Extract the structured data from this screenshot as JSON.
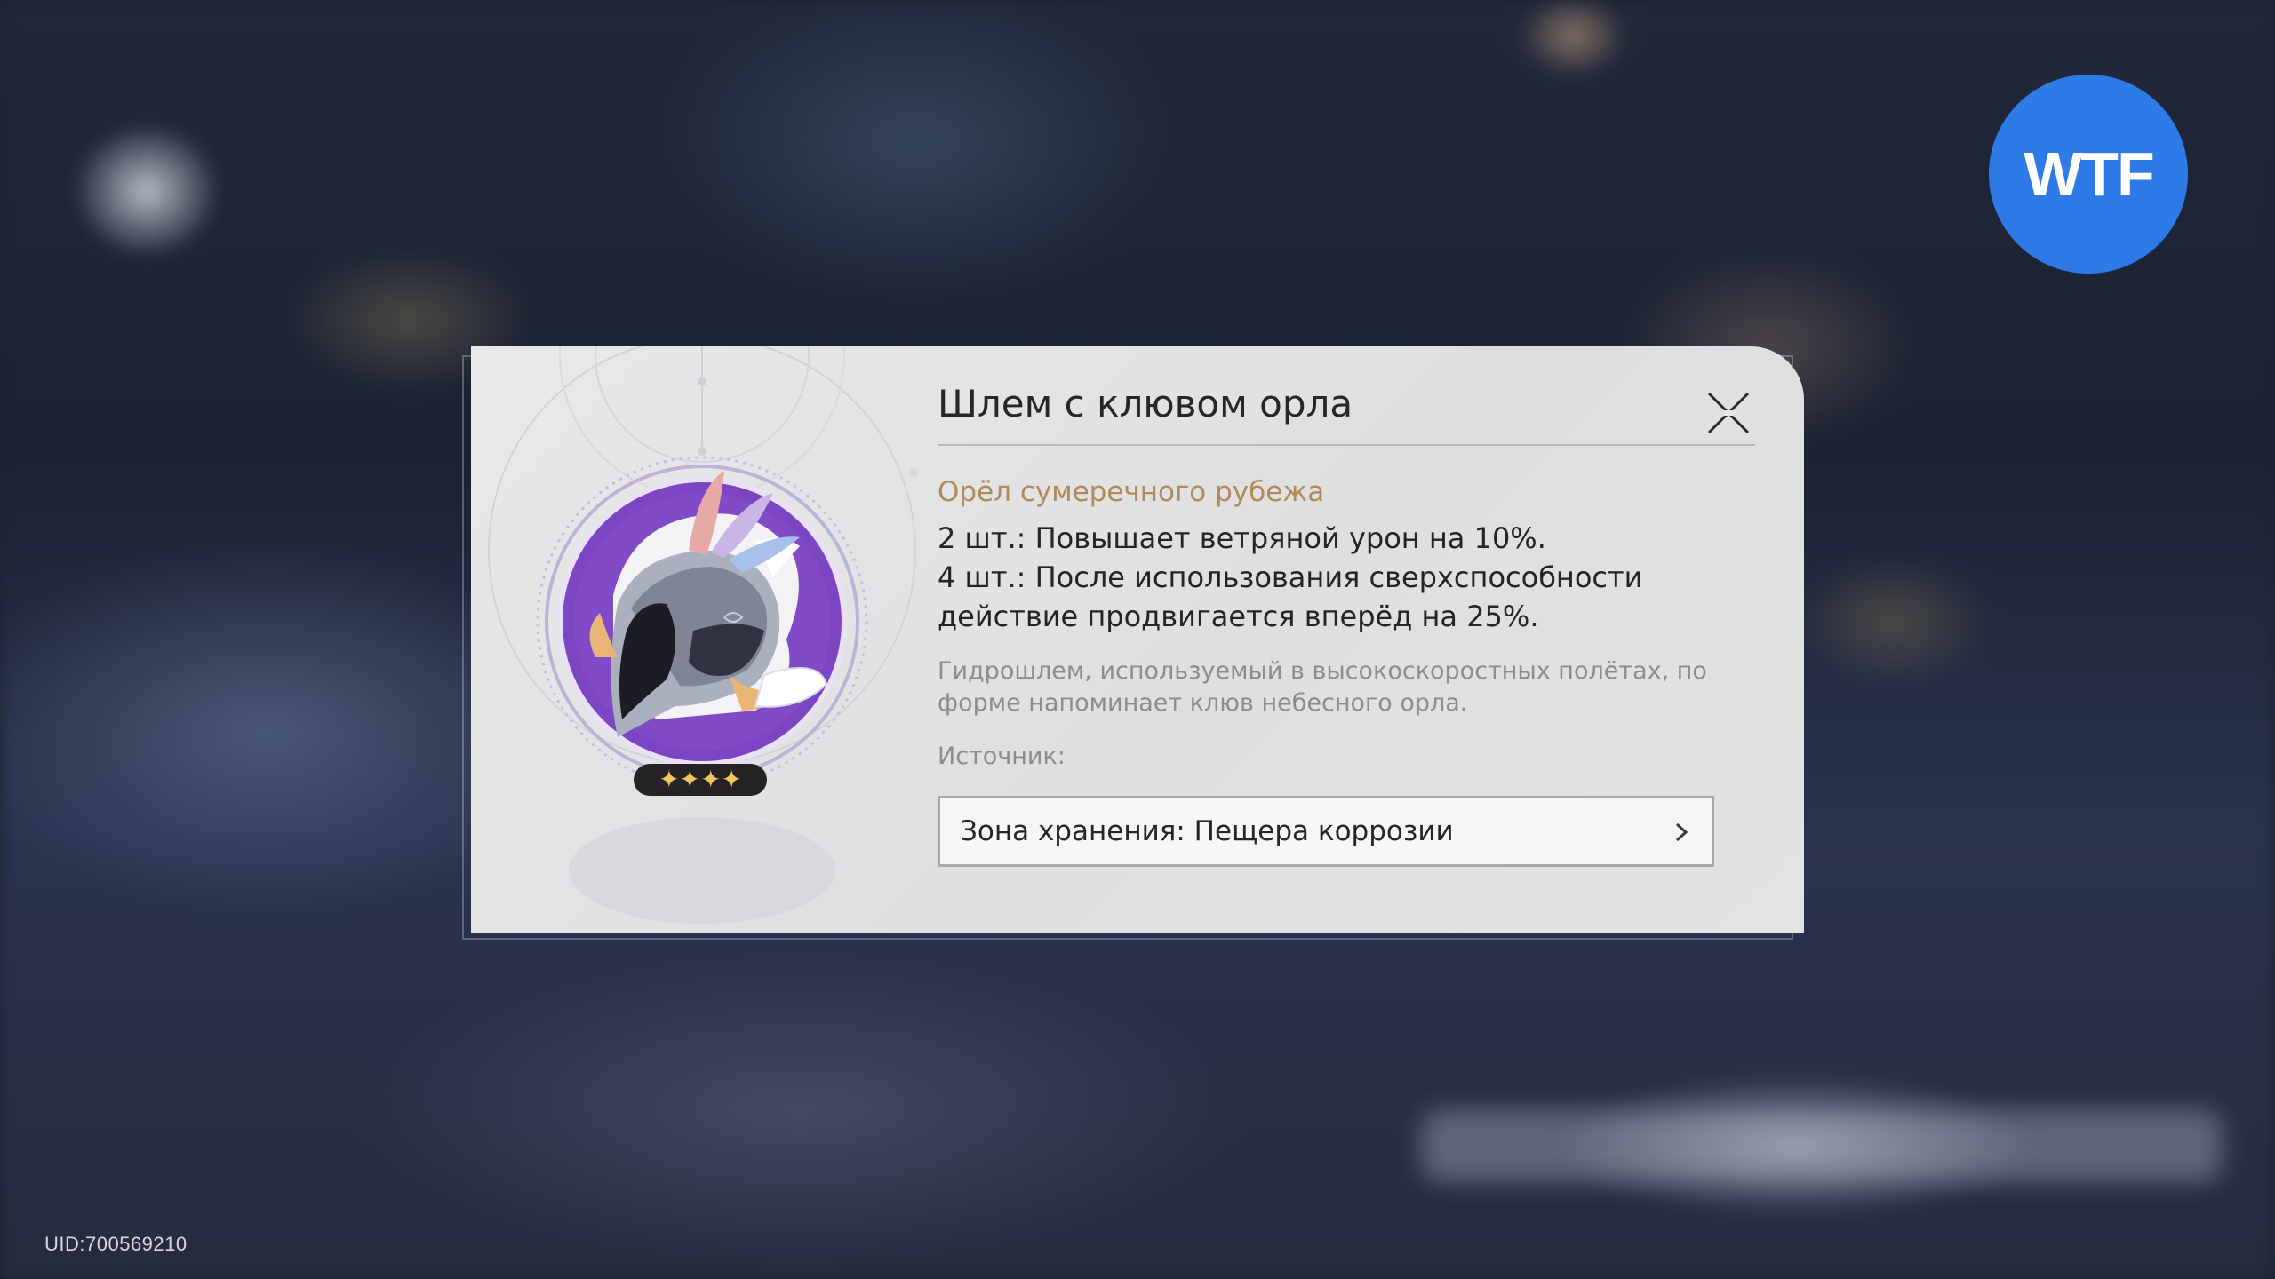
{
  "badge": {
    "text": "WTF",
    "color": "#2e7be8"
  },
  "uid": "UID:700569210",
  "item": {
    "title": "Шлем с клювом орла",
    "rarity_stars": 4,
    "star_glyphs": "✦✦✦✦",
    "set_name": "Орёл сумеречного рубежа",
    "effects": {
      "two_piece": "2 шт.: Повышает ветряной урон на 10%.",
      "four_piece": "4 шт.: После использования сверхспособности действие продвигается вперёд на 25%."
    },
    "description": "Гидрошлем, используемый в высокоскоростных полётах, по форме напоминает клюв небесного орла.",
    "source_label": "Источник:",
    "source_entry": "Зона хранения: Пещера коррозии"
  },
  "colors": {
    "set_name": "#b08a5b",
    "item_circle": "#7b45c4",
    "dialog_bg": "#e4e4e5"
  },
  "icons": [
    "close-icon",
    "chevron-right-icon",
    "star-icon",
    "eagle-helmet-icon"
  ]
}
